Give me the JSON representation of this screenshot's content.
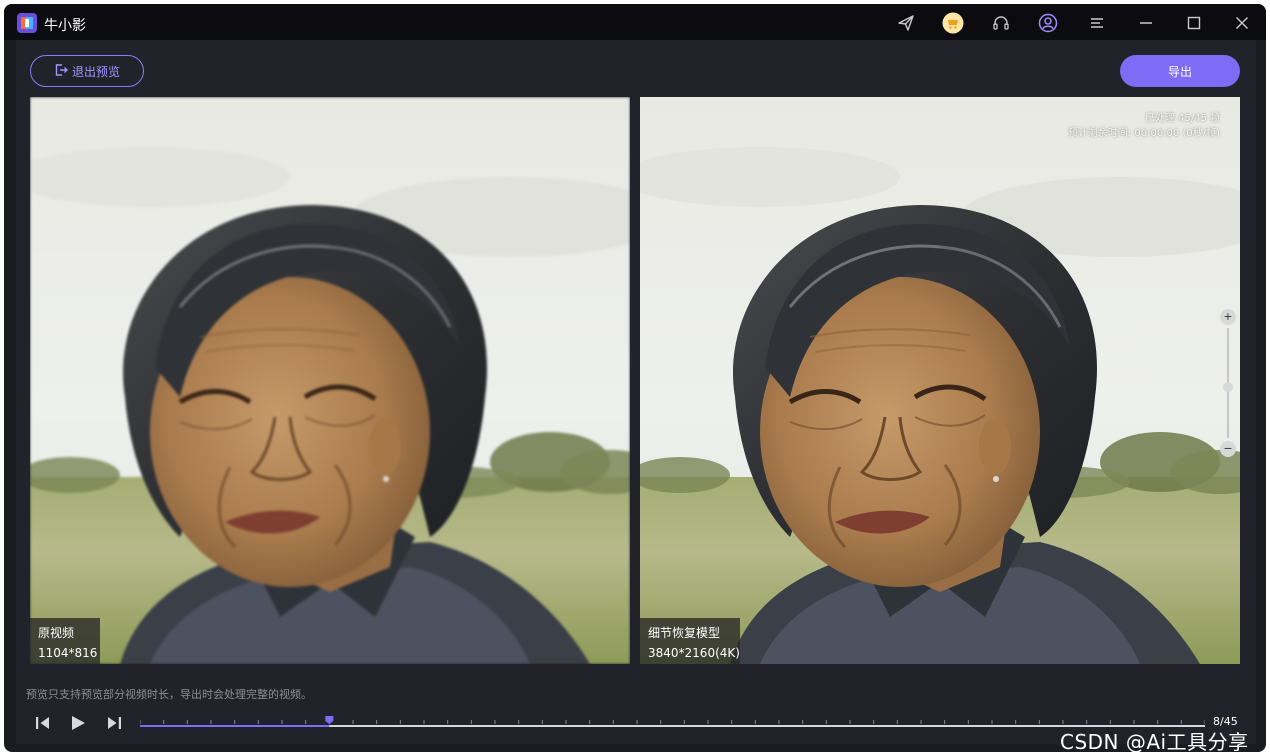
{
  "app": {
    "title": "牛小影"
  },
  "toolbar": {
    "exit_preview_label": "退出预览",
    "export_label": "导出"
  },
  "preview": {
    "left": {
      "name": "原视频",
      "resolution": "1104*816"
    },
    "right": {
      "name": "细节恢复模型",
      "resolution": "3840*2160(4K)"
    },
    "progress_line1": "已处理 45/45 帧",
    "progress_line2": "预计剩余时间: 00:00:00 (0秒/帧)"
  },
  "hint": "预览只支持预览部分视频时长，导出时会处理完整的视频。",
  "playback": {
    "current_frame": 8,
    "total_frames": 45,
    "frame_label": "8/45"
  },
  "watermark": "CSDN @Ai工具分享",
  "colors": {
    "accent": "#7f6bf5",
    "accent_text": "#a394ff",
    "background": "#22222b",
    "titlebar": "#0c0c10"
  },
  "icons": [
    "send-icon",
    "shop-icon",
    "headset-icon",
    "user-icon",
    "menu-icon",
    "minimize-icon",
    "maximize-icon",
    "close-icon",
    "exit-icon",
    "prev-frame-icon",
    "play-icon",
    "next-frame-icon",
    "zoom-plus-icon",
    "zoom-minus-icon"
  ]
}
